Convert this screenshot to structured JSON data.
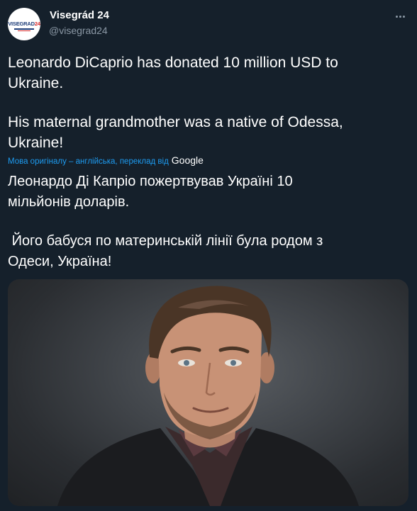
{
  "tweet": {
    "author": {
      "display_name": "Visegrád 24",
      "handle": "@visegrad24",
      "avatar_text_main": "VISEGRAD",
      "avatar_text_accent": "24"
    },
    "text_original_line1": "Leonardo DiCaprio has donated 10 million USD to\nUkraine.",
    "text_original_line2": "His maternal grandmother was a native of Odessa,\nUkraine!",
    "translation_note": "Мова оригіналу – англійська, переклад від",
    "translation_provider": "Google",
    "text_translated_line1": "Леонардо Ді Капріо пожертвував Україні 10\nмільйонів доларів.",
    "text_translated_line2": " Його бабуся по материнській лінії була родом з\nОдеси, Україна!",
    "media_alt": "Portrait photo of Leonardo DiCaprio"
  },
  "colors": {
    "background": "#15202b",
    "text_primary": "#ffffff",
    "text_secondary": "#8b98a5",
    "link": "#1d9bf0"
  },
  "icons": {
    "more": "more-horizontal-icon"
  }
}
